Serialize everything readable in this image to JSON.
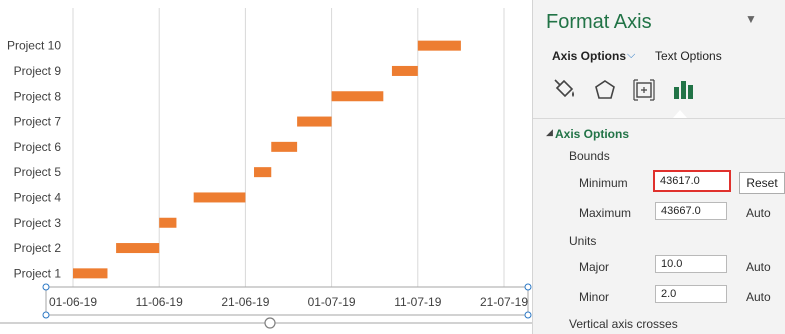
{
  "chart_data": {
    "type": "bar",
    "title": "",
    "xlabel": "",
    "ylabel": "",
    "categories": [
      "Project 1",
      "Project 2",
      "Project 3",
      "Project 4",
      "Project 5",
      "Project 6",
      "Project 7",
      "Project 8",
      "Project 9",
      "Project 10"
    ],
    "start": [
      "2019-06-01",
      "2019-06-06",
      "2019-06-11",
      "2019-06-15",
      "2019-06-22",
      "2019-06-24",
      "2019-06-27",
      "2019-07-01",
      "2019-07-08",
      "2019-07-11"
    ],
    "end": [
      "2019-06-05",
      "2019-06-11",
      "2019-06-13",
      "2019-06-21",
      "2019-06-24",
      "2019-06-27",
      "2019-07-01",
      "2019-07-07",
      "2019-07-11",
      "2019-07-16"
    ],
    "x_tick_labels": [
      "01-06-19",
      "11-06-19",
      "21-06-19",
      "01-07-19",
      "11-07-19",
      "21-07-19"
    ],
    "x_ticks": [
      "2019-06-01",
      "2019-06-11",
      "2019-06-21",
      "2019-07-01",
      "2019-07-11",
      "2019-07-21"
    ],
    "xlim": [
      "2019-06-01",
      "2019-07-21"
    ],
    "bar_color": "#ed7d31",
    "grid": true
  },
  "panel": {
    "title": "Format Axis",
    "tabs": {
      "axis_options": "Axis Options",
      "text_options": "Text Options"
    },
    "section": "Axis Options",
    "bounds_label": "Bounds",
    "minimum_label": "Minimum",
    "minimum_value": "43617.0",
    "maximum_label": "Maximum",
    "maximum_value": "43667.0",
    "reset_label": "Reset",
    "auto_label": "Auto",
    "units_label": "Units",
    "major_label": "Major",
    "major_value": "10.0",
    "minor_label": "Minor",
    "minor_value": "2.0",
    "vertical_crosses_label": "Vertical axis crosses",
    "accent_color": "#217346",
    "highlight_color": "#e0312d"
  }
}
